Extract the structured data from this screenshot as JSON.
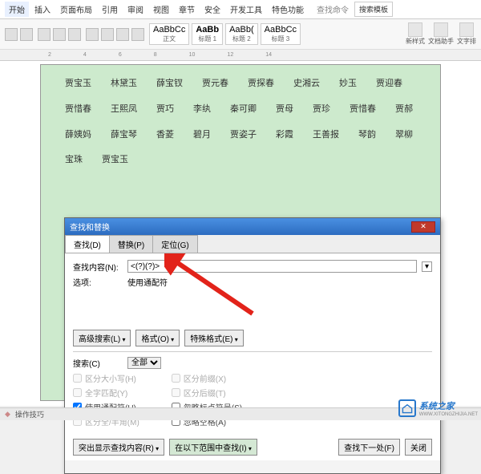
{
  "ribbon": {
    "tabs": [
      "开始",
      "插入",
      "页面布局",
      "引用",
      "审阅",
      "视图",
      "章节",
      "安全",
      "开发工具",
      "特色功能"
    ],
    "search_label": "查找命令",
    "search_placeholder": "搜索模板",
    "styles": [
      {
        "preview": "AaBbCc",
        "label": "正文"
      },
      {
        "preview": "AaBb",
        "label": "标题 1"
      },
      {
        "preview": "AaBb(",
        "label": "标题 2"
      },
      {
        "preview": "AaBbCc",
        "label": "标题 3"
      }
    ],
    "right_items": [
      "新样式",
      "文档助手",
      "文字排"
    ]
  },
  "ruler_ticks": [
    "2",
    "4",
    "6",
    "8",
    "10",
    "12",
    "14"
  ],
  "document": {
    "names": [
      "贾宝玉",
      "林黛玉",
      "薛宝钗",
      "贾元春",
      "贾探春",
      "史湘云",
      "妙玉",
      "贾迎春",
      "贾惜春",
      "王熙凤",
      "贾巧",
      "李纨",
      "秦可卿",
      "贾母",
      "贾珍",
      "贾惜春",
      "贾郝",
      "薛姨妈",
      "薛宝琴",
      "香菱",
      "碧月",
      "贾姿子",
      "彩霞",
      "王善报",
      "琴韵",
      "翠柳",
      "宝珠",
      "贾宝玉"
    ]
  },
  "dialog": {
    "title": "查找和替换",
    "tabs": {
      "find": "查找(D)",
      "replace": "替换(P)",
      "goto": "定位(G)"
    },
    "find_label": "查找内容(N):",
    "find_value": "<(?)(?)>",
    "options_label": "选项:",
    "options_value": "使用通配符",
    "btn_highlevel": "高级搜索(L)",
    "btn_format": "格式(O)",
    "btn_special": "特殊格式(E)",
    "search_label": "搜索(C)",
    "search_scope": "全部",
    "checks": {
      "case": "区分大小写(H)",
      "whole": "全字匹配(Y)",
      "wildcard": "使用通配符(U)",
      "width": "区分全/半角(M)",
      "prefix": "区分前缀(X)",
      "suffix": "区分后缀(T)",
      "punct": "忽略标点符号(S)",
      "space": "忽略空格(A)"
    },
    "btn_highlight": "突出显示查找内容(R)",
    "btn_inselect": "在以下范围中查找(I)",
    "btn_findnext": "查找下一处(F)",
    "btn_close": "关闭"
  },
  "status": {
    "ops": "操作技巧"
  },
  "watermark": {
    "text": "系统之家",
    "url": "WWW.XITONGZHIJIA.NET"
  }
}
